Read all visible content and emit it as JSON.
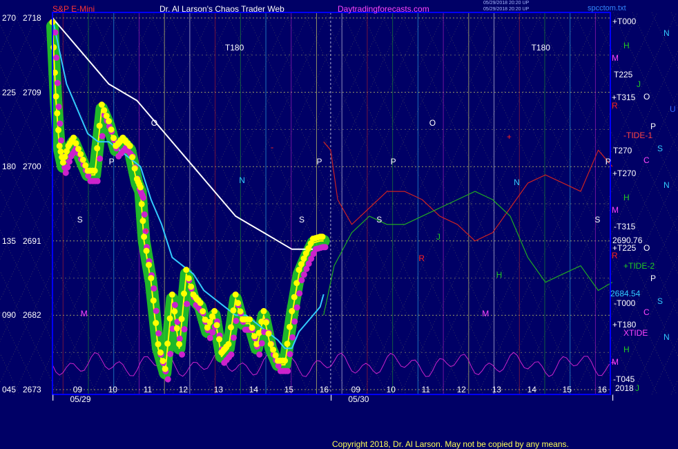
{
  "header": {
    "instrument": "S&P E-Mini",
    "title": "Dr. Al Larson's Chaos Trader Web",
    "site": "Daytradingforecasts.com",
    "stamp1": "05/29/2018 20:20 UP",
    "stamp2": "05/29/2018 20:20 UP",
    "file": "spcctom.txt"
  },
  "footer": {
    "copyright": "Copyright 2018, Dr. Al Larson. May not be copied by any means."
  },
  "colors": {
    "background": "#000066",
    "plot_border": "#0000ff",
    "price": "#ffff00",
    "price_glow": "#22cc22",
    "dots_high": "#ffff00",
    "dots_low": "#cc22cc",
    "avg_short": "#33ccff",
    "avg_long": "#ffffff",
    "red_line": "#cc2222",
    "green_line": "#22aa22",
    "magenta_line": "#cc22cc",
    "grid": "#ffff55"
  },
  "chart_data": {
    "type": "line",
    "left_axis_angle": [
      "270",
      "225",
      "180",
      "135",
      "090",
      "045"
    ],
    "left_axis_price": [
      "2718",
      "2709",
      "2700",
      "2691",
      "2682",
      "2673"
    ],
    "ylim": [
      2673,
      2718
    ],
    "x_hour_labels": [
      "09",
      "10",
      "11",
      "12",
      "13",
      "14",
      "15",
      "16",
      "09",
      "10",
      "11",
      "12",
      "13",
      "14",
      "15",
      "16"
    ],
    "x_date_labels": [
      "05/29",
      "05/30"
    ],
    "x_tick_marks": [
      "I",
      "I",
      "I"
    ],
    "price_labels": [
      "2690.76",
      "2684.54"
    ],
    "year_label": "2018",
    "plot_markers": [
      "T180",
      "T180",
      "O",
      "P",
      "P",
      "P",
      "S",
      "S",
      "S",
      "S",
      "N",
      "N",
      "O",
      "P",
      "M",
      "M",
      "H",
      "J",
      "R",
      "+",
      "+",
      "-"
    ],
    "right_labels": [
      {
        "text": "+T000",
        "color": "#ffffff"
      },
      {
        "text": "N",
        "color": "#33ccff"
      },
      {
        "text": "H",
        "color": "#22cc22"
      },
      {
        "text": "M",
        "color": "#ff44ff"
      },
      {
        "text": "T225",
        "color": "#ffffff"
      },
      {
        "text": "J",
        "color": "#22cc22"
      },
      {
        "text": "+T315",
        "color": "#ffffff"
      },
      {
        "text": "O",
        "color": "#ffffff"
      },
      {
        "text": "U",
        "color": "#3366ff"
      },
      {
        "text": "R",
        "color": "#ff2222"
      },
      {
        "text": "P",
        "color": "#ffffff"
      },
      {
        "text": "-TIDE-1",
        "color": "#ff4444"
      },
      {
        "text": "T270",
        "color": "#ffffff"
      },
      {
        "text": "S",
        "color": "#33ccff"
      },
      {
        "text": "C",
        "color": "#ff44ff"
      },
      {
        "text": "+T270",
        "color": "#ffffff"
      },
      {
        "text": "N",
        "color": "#33ccff"
      },
      {
        "text": "H",
        "color": "#22cc22"
      },
      {
        "text": "M",
        "color": "#ff44ff"
      },
      {
        "text": "-T315",
        "color": "#ffffff"
      },
      {
        "text": "+T225",
        "color": "#ffffff"
      },
      {
        "text": "O",
        "color": "#ffffff"
      },
      {
        "text": "R",
        "color": "#ff2222"
      },
      {
        "text": "+TIDE-2",
        "color": "#22cc22"
      },
      {
        "text": "P",
        "color": "#ffffff"
      },
      {
        "text": "-T000",
        "color": "#ffffff"
      },
      {
        "text": "S",
        "color": "#33ccff"
      },
      {
        "text": "C",
        "color": "#ff44ff"
      },
      {
        "text": "+T180",
        "color": "#ffffff"
      },
      {
        "text": "XTIDE",
        "color": "#ff44ff"
      },
      {
        "text": "N",
        "color": "#33ccff"
      },
      {
        "text": "H",
        "color": "#22cc22"
      },
      {
        "text": "M",
        "color": "#ff44ff"
      },
      {
        "text": "-T045",
        "color": "#ffffff"
      },
      {
        "text": "J",
        "color": "#22cc22"
      }
    ],
    "series": [
      {
        "name": "",
        "color": "#ffff00",
        "x": [
          0,
          0.1,
          0.2,
          0.3,
          0.45,
          0.6,
          0.8,
          1.0,
          1.2,
          1.4,
          1.6,
          1.8,
          2.0,
          2.2,
          2.4,
          2.5,
          2.6,
          2.8,
          3.0,
          3.2,
          3.4,
          3.6,
          3.8,
          4.0,
          4.2,
          4.4,
          4.6,
          4.8,
          5.0,
          5.2,
          5.4,
          5.6,
          5.8,
          6.0,
          6.2,
          6.4,
          6.6,
          6.8,
          7.0,
          7.2,
          7.4,
          7.6,
          7.7
        ],
        "y": [
          2717,
          2708,
          2702,
          2700,
          2702,
          2703,
          2701,
          2699,
          2699,
          2707,
          2705,
          2702,
          2703,
          2702,
          2698,
          2697,
          2691,
          2686,
          2678,
          2675,
          2684,
          2678,
          2687,
          2684,
          2683,
          2680,
          2682,
          2677,
          2678,
          2684,
          2681,
          2681,
          2678,
          2682,
          2678,
          2676,
          2676,
          2682,
          2687,
          2689,
          2690.76,
          2691,
          2691
        ]
      },
      {
        "name": "",
        "color": "#33ccff",
        "x": [
          0,
          0.2,
          0.4,
          0.7,
          1.0,
          1.3,
          1.6,
          1.9,
          2.2,
          2.5,
          2.8,
          3.1,
          3.4,
          3.7,
          4.0,
          4.3,
          4.6,
          4.9,
          5.2,
          5.5,
          5.8,
          6.1,
          6.4,
          6.6,
          6.8,
          7.0,
          7.2,
          7.4,
          7.6,
          7.7
        ],
        "y": [
          2718,
          2714,
          2710,
          2707,
          2704,
          2703,
          2703,
          2702,
          2701,
          2700,
          2696,
          2693,
          2689,
          2688,
          2687,
          2685,
          2684,
          2683,
          2682,
          2682,
          2681,
          2680,
          2679,
          2678,
          2678,
          2680,
          2681,
          2682,
          2683,
          2684.54
        ]
      },
      {
        "name": "",
        "color": "#ffffff",
        "x": [
          0,
          0.4,
          0.8,
          1.2,
          1.6,
          2.0,
          2.4,
          2.8,
          3.2,
          3.6,
          4.0,
          4.4,
          4.8,
          5.2,
          5.6,
          6.0,
          6.4,
          6.8,
          7.0,
          7.2,
          7.4,
          7.6,
          7.7
        ],
        "y": [
          2718,
          2716,
          2714,
          2712,
          2710,
          2709,
          2708,
          2706,
          2704,
          2702,
          2700,
          2698,
          2696,
          2694,
          2693,
          2692,
          2691,
          2690,
          2690,
          2690,
          2690,
          2690,
          2690
        ]
      },
      {
        "name": "",
        "color": "#cc2222",
        "x": [
          7.7,
          7.9,
          8.1,
          8.5,
          9.0,
          9.5,
          10.0,
          10.5,
          11.0,
          11.5,
          12.0,
          12.5,
          13.0,
          13.5,
          14.0,
          14.5,
          15.0,
          15.5,
          15.9
        ],
        "y": [
          2703,
          2702,
          2696,
          2693,
          2695,
          2697,
          2697,
          2696,
          2694,
          2693,
          2691,
          2692,
          2695,
          2698,
          2699,
          2698,
          2697,
          2702,
          2700
        ]
      },
      {
        "name": "",
        "color": "#22aa22",
        "x": [
          7.7,
          8.0,
          8.5,
          9.0,
          9.5,
          10.0,
          10.5,
          11.0,
          11.5,
          12.0,
          12.5,
          13.0,
          13.5,
          14.0,
          14.5,
          15.0,
          15.5,
          15.9
        ],
        "y": [
          2682,
          2688,
          2692,
          2694,
          2693,
          2693,
          2694,
          2695,
          2696,
          2697,
          2696,
          2694,
          2689,
          2686,
          2687,
          2688,
          2685,
          2686
        ]
      }
    ]
  }
}
